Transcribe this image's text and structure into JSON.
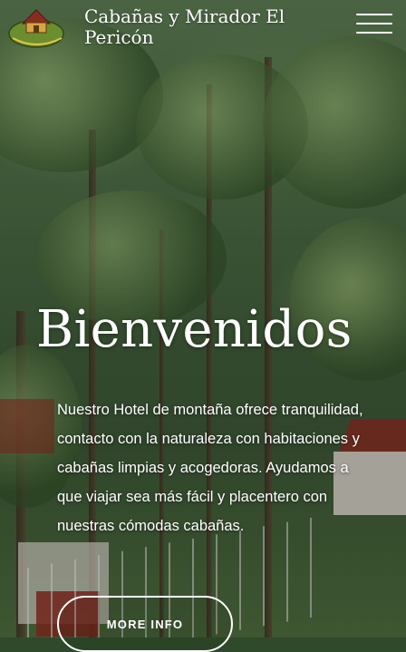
{
  "header": {
    "site_title": "Cabañas y Mirador El Pericón",
    "logo": {
      "text": "El Pericón",
      "icon": "cabin-logo-icon"
    },
    "menu_icon": "hamburger-menu-icon"
  },
  "hero": {
    "title": "Bienvenidos",
    "description": "Nuestro Hotel de montaña ofrece tranquilidad, contacto con la naturaleza con habitaciones y cabañas limpias y acogedoras. Ayudamos a que viajar sea más fácil y placentero con nuestras cómodas cabañas.",
    "button_label": "MORE INFO"
  },
  "colors": {
    "text": "#ffffff",
    "roof": "#8a2d21",
    "foliage": "#4b6a44"
  }
}
